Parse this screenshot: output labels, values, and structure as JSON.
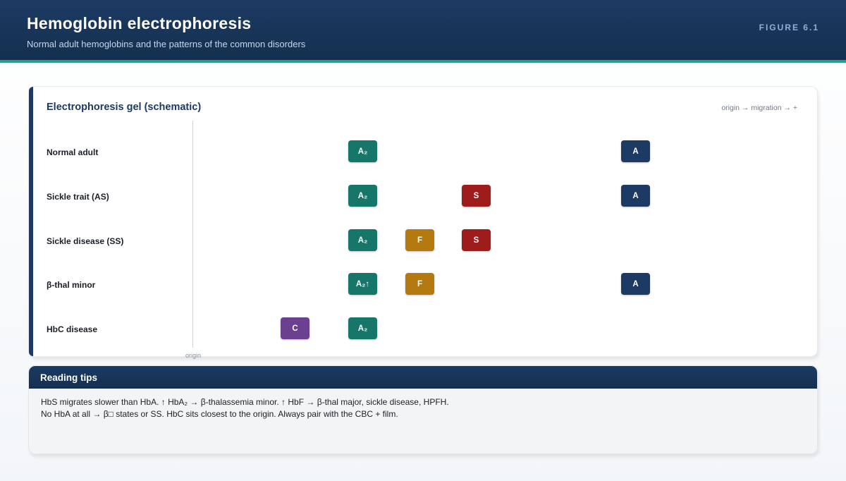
{
  "header": {
    "title": "Hemoglobin electrophoresis",
    "subtitle": "Normal adult hemoglobins and the patterns of the common disorders",
    "figure_label": "FIGURE 6.1"
  },
  "gel": {
    "title": "Electrophoresis gel (schematic)",
    "migration_note": "origin → migration → +",
    "origin_label": "origin",
    "lanes": [
      {
        "label": "Normal adult",
        "bands": [
          {
            "text": "A₂",
            "kind": "a2"
          },
          {
            "text": "A",
            "kind": "a"
          }
        ]
      },
      {
        "label": "Sickle trait (AS)",
        "bands": [
          {
            "text": "A₂",
            "kind": "a2"
          },
          {
            "text": "S",
            "kind": "s"
          },
          {
            "text": "A",
            "kind": "a"
          }
        ]
      },
      {
        "label": "Sickle disease (SS)",
        "bands": [
          {
            "text": "A₂",
            "kind": "a2"
          },
          {
            "text": "F",
            "kind": "f"
          },
          {
            "text": "S",
            "kind": "s"
          }
        ]
      },
      {
        "label": "β-thal minor",
        "bands": [
          {
            "text": "A₂↑",
            "kind": "a2"
          },
          {
            "text": "F",
            "kind": "f"
          },
          {
            "text": "A",
            "kind": "a"
          }
        ]
      },
      {
        "label": "HbC disease",
        "bands": [
          {
            "text": "C",
            "kind": "c"
          },
          {
            "text": "A₂",
            "kind": "a2"
          }
        ]
      }
    ],
    "band_colors": {
      "a2": "#17766a",
      "a": "#1c3a63",
      "s": "#9e1c1c",
      "f": "#b47a10",
      "c": "#6c4090"
    }
  },
  "tips": {
    "title": "Reading tips",
    "lines": [
      "HbS migrates slower than HbA. ↑ HbA₂ → β-thalassemia minor. ↑ HbF → β-thal major, sickle disease, HPFH.",
      "No HbA at all → β□ states or SS. HbC sits closest to the origin. Always pair with the CBC + film."
    ]
  }
}
